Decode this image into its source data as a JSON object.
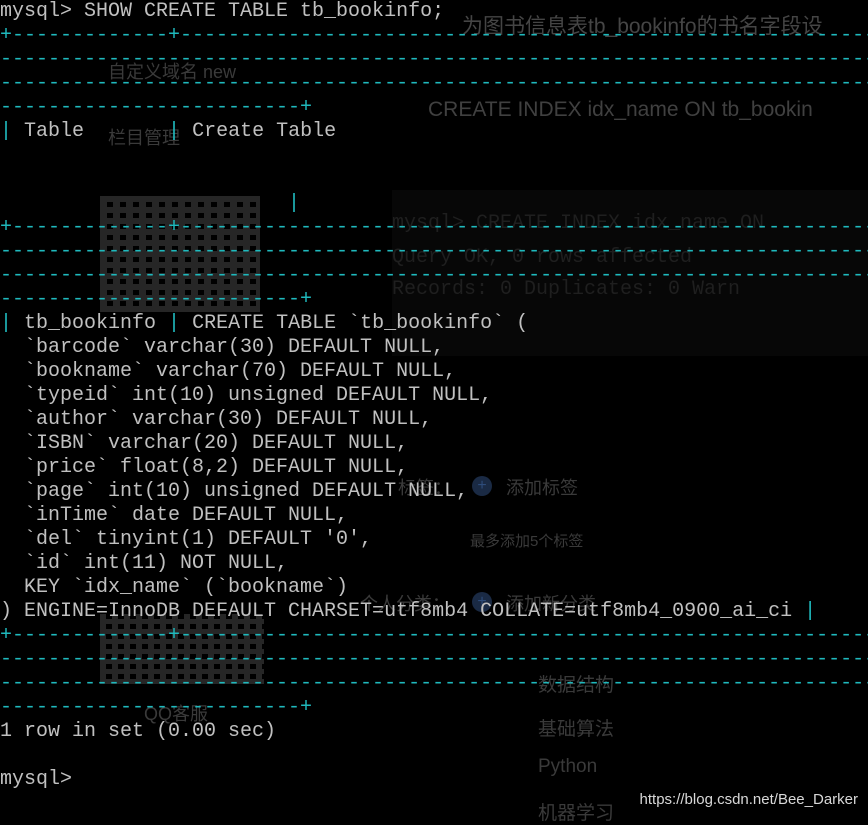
{
  "background_text": {
    "note": "为图书信息表tb_bookinfo的书名字段设",
    "label_1": "自定义域名 new",
    "code_1": "CREATE INDEX idx_name ON tb_bookin",
    "label_2": "栏目管理",
    "tag_label": "标签：",
    "add_tag": "添加标签",
    "tag_hint": "最多添加5个标签",
    "category_label": "个人分类：",
    "add_category": "添加新分类",
    "items": [
      "数据结构",
      "基础算法",
      "Python",
      "机器学习"
    ],
    "qq_label": "QQ客服",
    "block_lines": [
      "mysql> CREATE INDEX idx_name ON",
      "Query OK, 0 rows affected",
      "Records: 0  Duplicates: 0  Warn"
    ]
  },
  "terminal": {
    "lines": [
      {
        "text": "mysql> SHOW CREATE TABLE tb_bookinfo;",
        "kind": "prompt"
      },
      {
        "text": "+-------------+------------------------------------------------------------------------------------------------------------------------------------------------------------------------------------------------------------------------------------------------------------------------------------------------------------------------------------------------------------------------------------------------------------------------------------------------------------------------------+",
        "kind": "border"
      },
      {
        "text": "-----------------------------------------------------------------------------------------------------------------------------------------------------------------------------",
        "kind": "border"
      },
      {
        "text": "-----------------------------------------------------------------------------------------------------------------------------------------------------------------------------",
        "kind": "border"
      },
      {
        "text": "-------------------------+",
        "kind": "border"
      },
      {
        "text": "| Table       | Create Table",
        "kind": "header"
      },
      {
        "text": "",
        "kind": "blank"
      },
      {
        "text": "",
        "kind": "blank"
      },
      {
        "text": "                        |",
        "kind": "header"
      },
      {
        "text": "+-------------+------------------------------------------------------------------------------------------------------------------------------------------------------------------------------------------------------------------------------------------------------------------------------------------------------------------------------------------------------------------------------------------------------------------------------------------------------------------------------+",
        "kind": "border"
      },
      {
        "text": "-----------------------------------------------------------------------------------------------------------------------------------------------------------------------------",
        "kind": "border"
      },
      {
        "text": "-----------------------------------------------------------------------------------------------------------------------------------------------------------------------------",
        "kind": "border"
      },
      {
        "text": "-------------------------+",
        "kind": "border"
      },
      {
        "text": "| tb_bookinfo | CREATE TABLE `tb_bookinfo` (",
        "kind": "row"
      },
      {
        "text": "  `barcode` varchar(30) DEFAULT NULL,",
        "kind": "row"
      },
      {
        "text": "  `bookname` varchar(70) DEFAULT NULL,",
        "kind": "row"
      },
      {
        "text": "  `typeid` int(10) unsigned DEFAULT NULL,",
        "kind": "row"
      },
      {
        "text": "  `author` varchar(30) DEFAULT NULL,",
        "kind": "row"
      },
      {
        "text": "  `ISBN` varchar(20) DEFAULT NULL,",
        "kind": "row"
      },
      {
        "text": "  `price` float(8,2) DEFAULT NULL,",
        "kind": "row"
      },
      {
        "text": "  `page` int(10) unsigned DEFAULT NULL,",
        "kind": "row"
      },
      {
        "text": "  `inTime` date DEFAULT NULL,",
        "kind": "row"
      },
      {
        "text": "  `del` tinyint(1) DEFAULT '0',",
        "kind": "row"
      },
      {
        "text": "  `id` int(11) NOT NULL,",
        "kind": "row"
      },
      {
        "text": "  KEY `idx_name` (`bookname`)",
        "kind": "row"
      },
      {
        "text": ") ENGINE=InnoDB DEFAULT CHARSET=utf8mb4 COLLATE=utf8mb4_0900_ai_ci |",
        "kind": "row"
      },
      {
        "text": "+-------------+------------------------------------------------------------------------------------------------------------------------------------------------------------------------------------------------------------------------------------------------------------------------------------------------------------------------------------------------------------------------------------------------------------------------------------------------------------------------------+",
        "kind": "border"
      },
      {
        "text": "-----------------------------------------------------------------------------------------------------------------------------------------------------------------------------",
        "kind": "border"
      },
      {
        "text": "-----------------------------------------------------------------------------------------------------------------------------------------------------------------------------",
        "kind": "border"
      },
      {
        "text": "-------------------------+",
        "kind": "border"
      },
      {
        "text": "1 row in set (0.00 sec)",
        "kind": "result"
      },
      {
        "text": "",
        "kind": "blank"
      },
      {
        "text": "mysql>",
        "kind": "prompt"
      }
    ]
  },
  "watermark": "https://blog.csdn.net/Bee_Darker",
  "colors": {
    "background": "#000000",
    "text": "#c0c0c0",
    "table_border": "#1fb9bd"
  }
}
